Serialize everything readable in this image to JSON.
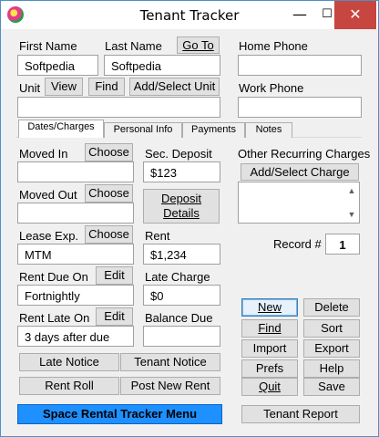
{
  "window": {
    "title": "Tenant Tracker",
    "minimize_glyph": "—",
    "maximize_glyph": "☐",
    "close_glyph": "✕"
  },
  "name": {
    "first_label": "First Name",
    "first_value": "Softpedia",
    "last_label": "Last Name",
    "last_value": "Softpedia",
    "goto_label": "Go To"
  },
  "unit": {
    "label": "Unit",
    "value": "",
    "view_label": "View",
    "find_label": "Find",
    "add_select_label": "Add/Select Unit"
  },
  "phones": {
    "home_label": "Home Phone",
    "home_value": "",
    "work_label": "Work Phone",
    "work_value": ""
  },
  "tabs": [
    {
      "label": "Dates/Charges",
      "active": true
    },
    {
      "label": "Personal Info",
      "active": false
    },
    {
      "label": "Payments",
      "active": false
    },
    {
      "label": "Notes",
      "active": false
    }
  ],
  "dates": {
    "moved_in_label": "Moved In",
    "moved_in_value": "",
    "moved_out_label": "Moved Out",
    "moved_out_value": "",
    "lease_exp_label": "Lease Exp.",
    "lease_exp_value": "MTM",
    "choose_label": "Choose",
    "rent_due_label": "Rent Due On",
    "rent_due_value": "Fortnightly",
    "rent_late_label": "Rent Late On",
    "rent_late_value": "3 days after due",
    "edit_label": "Edit"
  },
  "charges": {
    "sec_deposit_label": "Sec. Deposit",
    "sec_deposit_value": "$123",
    "deposit_details_line1": "Deposit",
    "deposit_details_line2": "Details",
    "rent_label": "Rent",
    "rent_value": "$1,234",
    "late_charge_label": "Late Charge",
    "late_charge_value": "$0",
    "balance_due_label": "Balance Due",
    "balance_due_value": ""
  },
  "recurring": {
    "label": "Other Recurring Charges",
    "add_select_label": "Add/Select Charge"
  },
  "record": {
    "label": "Record #",
    "value": "1"
  },
  "actions": {
    "new": "New",
    "delete": "Delete",
    "find": "Find",
    "sort": "Sort",
    "import": "Import",
    "export": "Export",
    "prefs": "Prefs",
    "help": "Help",
    "quit": "Quit",
    "save": "Save",
    "tenant_report": "Tenant Report"
  },
  "notices": {
    "late_notice": "Late Notice",
    "tenant_notice": "Tenant Notice",
    "rent_roll": "Rent Roll",
    "post_new_rent": "Post New Rent",
    "menu": "Space Rental Tracker Menu"
  }
}
